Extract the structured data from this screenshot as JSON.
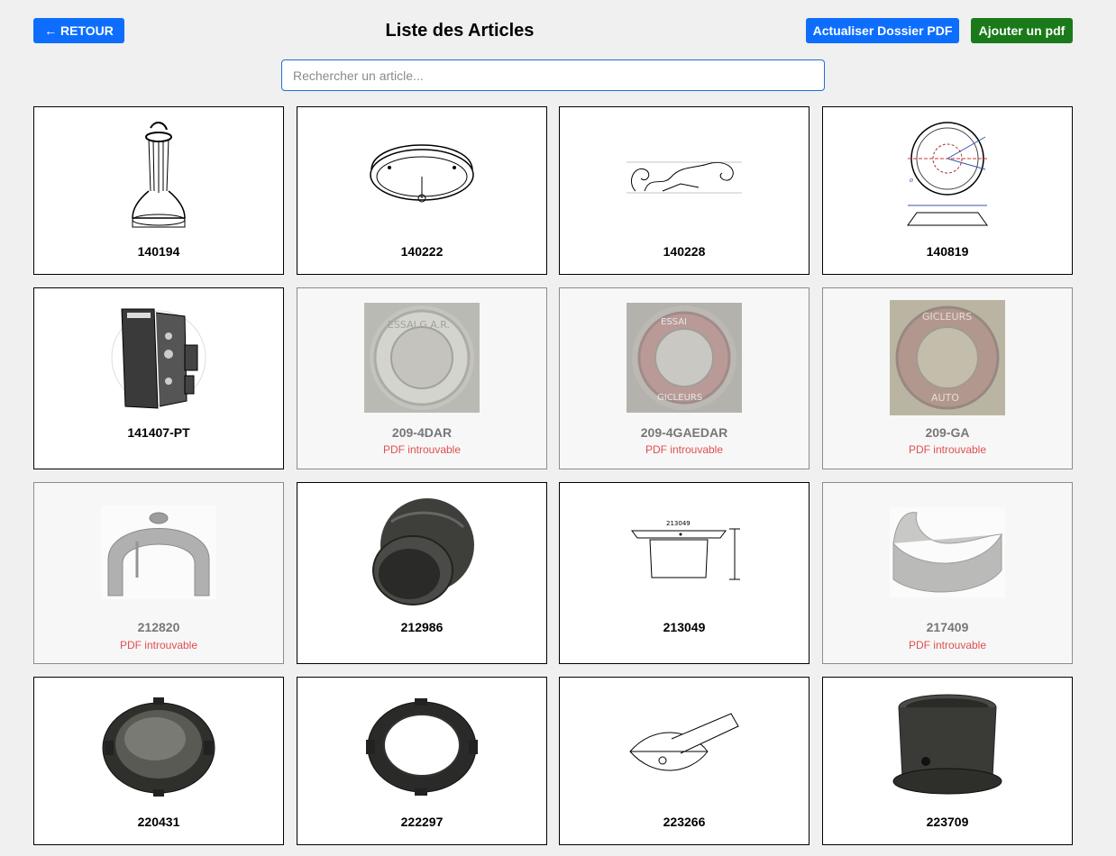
{
  "header": {
    "back_label": "← RETOUR",
    "title": "Liste des Articles",
    "refresh_label": "Actualiser Dossier PDF",
    "add_label": "Ajouter un pdf"
  },
  "search": {
    "placeholder": "Rechercher un article...",
    "value": ""
  },
  "colors": {
    "primary": "#0d6efd",
    "success": "#1a7a1a",
    "error_text": "#e05050",
    "page_bg": "#f0f0f0"
  },
  "missing_label": "PDF introuvable",
  "articles": [
    {
      "code": "140194",
      "missing": false,
      "icon": "pillar-drawing-icon"
    },
    {
      "code": "140222",
      "missing": false,
      "icon": "dome-drawing-icon"
    },
    {
      "code": "140228",
      "missing": false,
      "icon": "scroll-ornament-icon"
    },
    {
      "code": "140819",
      "missing": false,
      "icon": "circle-blueprint-icon"
    },
    {
      "code": "141407-PT",
      "missing": false,
      "icon": "bracket-part-icon"
    },
    {
      "code": "209-4DAR",
      "missing": true,
      "icon": "stamped-disc-icon"
    },
    {
      "code": "209-4GAEDAR",
      "missing": true,
      "icon": "stamped-disc-red-icon"
    },
    {
      "code": "209-GA",
      "missing": true,
      "icon": "stamped-disc-rust-icon"
    },
    {
      "code": "212820",
      "missing": true,
      "icon": "half-ring-icon"
    },
    {
      "code": "212986",
      "missing": false,
      "icon": "sphere-sleeve-icon"
    },
    {
      "code": "213049",
      "missing": false,
      "icon": "flange-drawing-icon"
    },
    {
      "code": "217409",
      "missing": true,
      "icon": "curved-shell-icon"
    },
    {
      "code": "220431",
      "missing": false,
      "icon": "dome-lens-icon"
    },
    {
      "code": "222297",
      "missing": false,
      "icon": "lug-ring-icon"
    },
    {
      "code": "223266",
      "missing": false,
      "icon": "tube-bracket-icon"
    },
    {
      "code": "223709",
      "missing": false,
      "icon": "cylinder-sleeve-icon"
    }
  ]
}
